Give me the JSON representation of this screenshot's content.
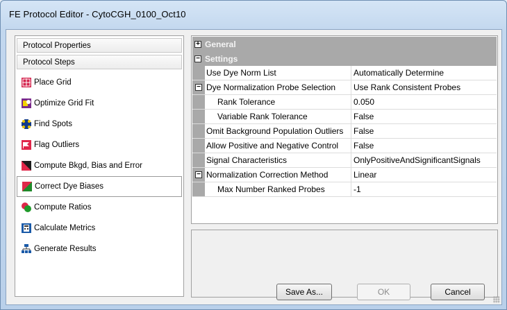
{
  "window": {
    "title": "FE Protocol Editor - CytoCGH_0100_Oct10"
  },
  "left": {
    "header1": "Protocol Properties",
    "header2": "Protocol Steps",
    "steps": [
      {
        "label": "Place Grid",
        "icon": "place-grid-icon"
      },
      {
        "label": "Optimize Grid Fit",
        "icon": "optimize-grid-fit-icon"
      },
      {
        "label": "Find Spots",
        "icon": "find-spots-icon"
      },
      {
        "label": "Flag Outliers",
        "icon": "flag-outliers-icon"
      },
      {
        "label": "Compute Bkgd, Bias and Error",
        "icon": "compute-bkgd-icon"
      },
      {
        "label": "Correct Dye Biases",
        "icon": "correct-dye-biases-icon"
      },
      {
        "label": "Compute Ratios",
        "icon": "compute-ratios-icon"
      },
      {
        "label": "Calculate Metrics",
        "icon": "calculate-metrics-icon"
      },
      {
        "label": "Generate Results",
        "icon": "generate-results-icon"
      }
    ],
    "selected_step": "Correct Dye Biases"
  },
  "grid": {
    "categories": [
      {
        "label": "General",
        "toggle": "+"
      },
      {
        "label": "Settings",
        "toggle": "−"
      }
    ],
    "rows": [
      {
        "name": "Use Dye Norm List",
        "value": "Automatically Determine"
      },
      {
        "name": "Dye Normalization Probe Selection",
        "value": "Use Rank Consistent Probes",
        "toggle": "−"
      },
      {
        "name": "Rank Tolerance",
        "value": "0.050",
        "indent": true
      },
      {
        "name": "Variable Rank Tolerance",
        "value": "False",
        "indent": true
      },
      {
        "name": "Omit Background Population Outliers",
        "value": "False"
      },
      {
        "name": "Allow Positive and Negative Control",
        "value": "False"
      },
      {
        "name": "Signal Characteristics",
        "value": "OnlyPositiveAndSignificantSignals"
      },
      {
        "name": "Normalization Correction Method",
        "value": "Linear",
        "toggle": "−"
      },
      {
        "name": "Max Number Ranked Probes",
        "value": "-1",
        "indent": true
      }
    ]
  },
  "buttons": {
    "save_as": "Save As...",
    "ok": "OK",
    "cancel": "Cancel"
  }
}
